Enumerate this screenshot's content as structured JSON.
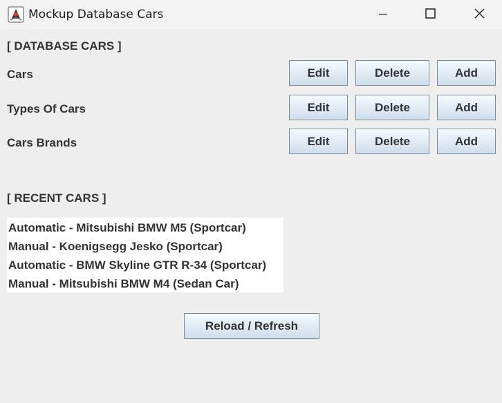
{
  "window": {
    "title": "Mockup Database Cars"
  },
  "database_section": {
    "heading": "[ DATABASE CARS ]",
    "rows": [
      {
        "label": "Cars",
        "edit": "Edit",
        "delete": "Delete",
        "add": "Add"
      },
      {
        "label": "Types Of Cars",
        "edit": "Edit",
        "delete": "Delete",
        "add": "Add"
      },
      {
        "label": "Cars Brands",
        "edit": "Edit",
        "delete": "Delete",
        "add": "Add"
      }
    ]
  },
  "recent_section": {
    "heading": "[ RECENT CARS ]",
    "items": [
      "Automatic - Mitsubishi BMW M5 (Sportcar)",
      "Manual - Koenigsegg Jesko (Sportcar)",
      "Automatic - BMW Skyline GTR R-34 (Sportcar)",
      "Manual - Mitsubishi BMW M4 (Sedan Car)"
    ]
  },
  "reload_button": {
    "label": "Reload / Refresh"
  },
  "icons": {
    "app": "java-duke-icon",
    "minimize": "minimize-icon",
    "maximize": "maximize-icon",
    "close": "close-icon"
  }
}
